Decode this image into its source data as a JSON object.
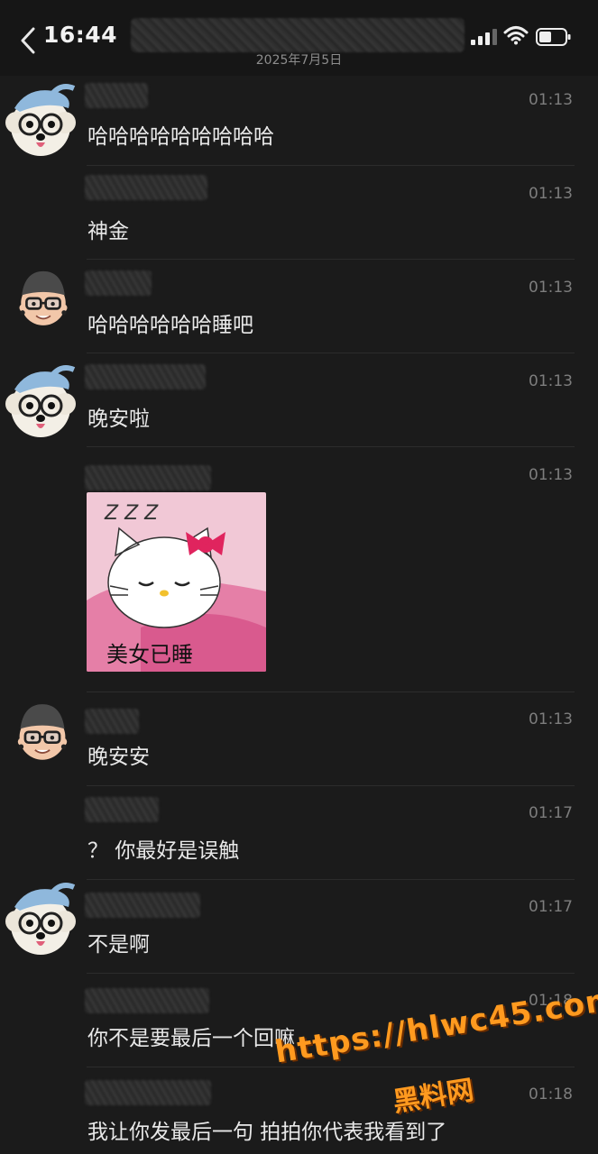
{
  "status": {
    "time": "16:44",
    "date": "2025年7月5日"
  },
  "messages": [
    {
      "time": "01:13",
      "text": "哈哈哈哈哈哈哈哈哈",
      "avatar": "dog-with-cap-glasses"
    },
    {
      "time": "01:13",
      "text": "神金",
      "avatar": ""
    },
    {
      "time": "01:13",
      "text": "哈哈哈哈哈哈睡吧",
      "avatar": "memoji-beanie-glasses"
    },
    {
      "time": "01:13",
      "text": "晚安啦",
      "avatar": "dog-with-cap-glasses"
    },
    {
      "time": "01:13",
      "sticker_caption": "美女已睡",
      "sticker_zzz": "Z Z Z",
      "avatar": ""
    },
    {
      "time": "01:13",
      "text": "晚安安",
      "avatar": "memoji-beanie-glasses"
    },
    {
      "time": "01:17",
      "text": "？ 你最好是误触",
      "avatar": ""
    },
    {
      "time": "01:17",
      "text": "不是啊",
      "avatar": "dog-with-cap-glasses"
    },
    {
      "time": "01:18",
      "text": "你不是要最后一个回嘛",
      "avatar": ""
    },
    {
      "time": "01:18",
      "text": "我让你发最后一句 拍拍你代表我看到了",
      "avatar": ""
    }
  ],
  "watermark": {
    "url": "https://hlwc45.com",
    "label": "黑料网"
  },
  "colors": {
    "background": "#1b1b1b",
    "text": "#e8e8e8",
    "time": "#7d7d7d",
    "watermark": "#ff9a1f"
  }
}
